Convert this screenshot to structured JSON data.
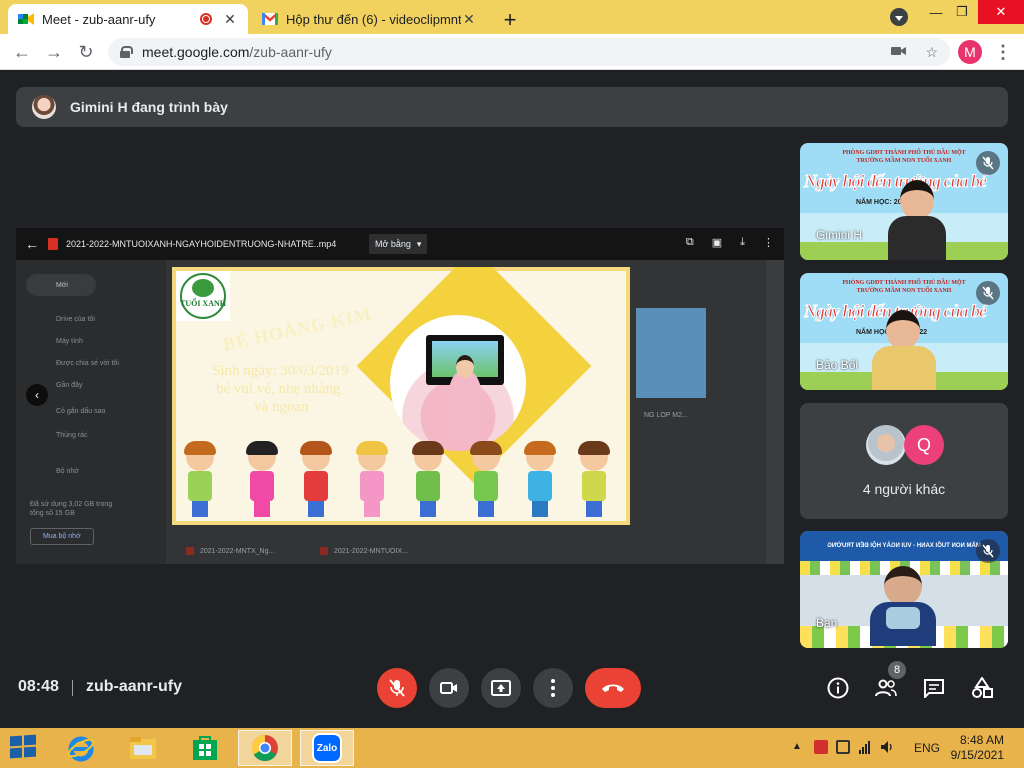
{
  "browser": {
    "tabs": [
      {
        "title": "Meet - zub-aanr-ufy",
        "icon": "google-meet-icon",
        "recording": true
      },
      {
        "title": "Hộp thư đến (6) - videoclipmntuo",
        "icon": "gmail-icon"
      }
    ],
    "url_host": "meet.google.com",
    "url_path": "/zub-aanr-ufy",
    "profile_initial": "M"
  },
  "meet": {
    "presenter_text": "Gimini H đang trình bày",
    "meeting_time": "08:48",
    "meeting_code": "zub-aanr-ufy",
    "people_count": "8",
    "colors": {
      "background": "#202124",
      "danger": "#ea4335",
      "control": "#3c4043"
    }
  },
  "shared_screen": {
    "file_name": "2021-2022-MNTUOIXANH-NGAYHOIDENTRUONG-NHATRE..mp4",
    "open_with_label": "Mở bằng",
    "drive": {
      "new_label": "Mới",
      "side_items": [
        "Drive của tôi",
        "Máy tính",
        "Được chia sẻ với tôi",
        "Gần đây",
        "Có gắn dấu sao",
        "Thùng rác",
        "Bộ nhớ"
      ],
      "storage_text": "Đã sử dụng 3,02 GB trong tổng số 15 GB",
      "buy_storage": "Mua bộ nhớ",
      "files": [
        "2021-2022-MNTX_Ng...",
        "2021-2022-MNTUOIX...",
        "NG LOP M2..."
      ]
    },
    "slide": {
      "logo_text": "TUỔI XANH",
      "title": "BÉ HOÀNG KIM",
      "line1": "Sinh ngày: 30/03/2019",
      "line2": "bé vui vẻ, nhẹ nhàng",
      "line3": "và ngoan"
    }
  },
  "participants": [
    {
      "name": "Gimini H",
      "muted": true,
      "bg_title": "Ngày hội đến trường của bé",
      "bg_school": "PHÒNG GDĐT THÀNH PHỐ THỦ DẦU MỘT\nTRƯỜNG MẦM NON TUỔI XANH",
      "bg_year": "NĂM HỌC: 2021-2022"
    },
    {
      "name": "Bảo Bối",
      "muted": true,
      "bg_title": "Ngày hội đến trường của bé",
      "bg_school": "PHÒNG GDĐT THÀNH PHỐ THỦ DẦU MỘT\nTRƯỜNG MẦM NON TUỔI XANH",
      "bg_year": "NĂM HỌC: 2021-2022"
    },
    {
      "others_text": "4 người khác",
      "initial": "Q"
    },
    {
      "name": "Bạn",
      "muted": true,
      "bg_banner": "MẦM NON TUỔI XANH - VUI NGÀY HỘI ĐẾN TRƯỜNG"
    }
  ],
  "taskbar": {
    "apps": [
      "internet-explorer-icon",
      "file-explorer-icon",
      "store-icon",
      "chrome-icon",
      "zalo-icon"
    ],
    "zalo_label": "Zalo",
    "language": "ENG",
    "time": "8:48 AM",
    "date": "9/15/2021"
  }
}
